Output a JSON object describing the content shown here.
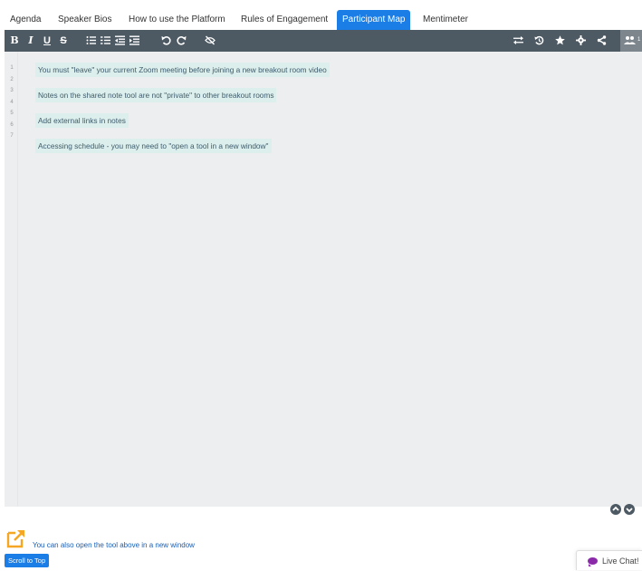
{
  "tabs": [
    {
      "label": "Agenda",
      "active": false
    },
    {
      "label": "Speaker Bios",
      "active": false
    },
    {
      "label": "How to use the Platform",
      "active": false
    },
    {
      "label": "Rules of Engagement",
      "active": false
    },
    {
      "label": "Participant Map",
      "active": true
    },
    {
      "label": "Mentimeter",
      "active": false
    }
  ],
  "toolbar": {
    "bold": "B",
    "italic": "I",
    "underline": "U",
    "strike": "S",
    "users_count": "1",
    "icons": [
      "bold-icon",
      "italic-icon",
      "underline-icon",
      "strikethrough-icon",
      "bulleted-list-icon",
      "numbered-list-icon",
      "outdent-icon",
      "indent-icon",
      "undo-icon",
      "redo-icon",
      "hide-icon",
      "swap-icon",
      "history-icon",
      "star-icon",
      "gear-icon",
      "share-icon",
      "users-icon"
    ]
  },
  "editor": {
    "line_numbers": [
      "1",
      "2",
      "3",
      "4",
      "5",
      "6",
      "7"
    ],
    "lines": [
      "You must \"leave\" your current Zoom meeting before joining a new breakout room video",
      "Notes on the shared note tool are not \"private\" to other breakout rooms",
      "Add external links in notes",
      "Accessing schedule - you may need to \"open a tool in a new window\""
    ]
  },
  "footer": {
    "open_window_text": "You can also open the tool above in a new window",
    "scroll_top_label": "Scroll to Top",
    "live_chat_label": "Live Chat!"
  },
  "colors": {
    "accent": "#1a7ee6",
    "toolbar_bg": "#4d5963",
    "editor_bg": "#eceeef",
    "highlight": "#dcefed",
    "new_window_icon": "#f5a623",
    "chat_bubble": "#8a2aa8"
  }
}
